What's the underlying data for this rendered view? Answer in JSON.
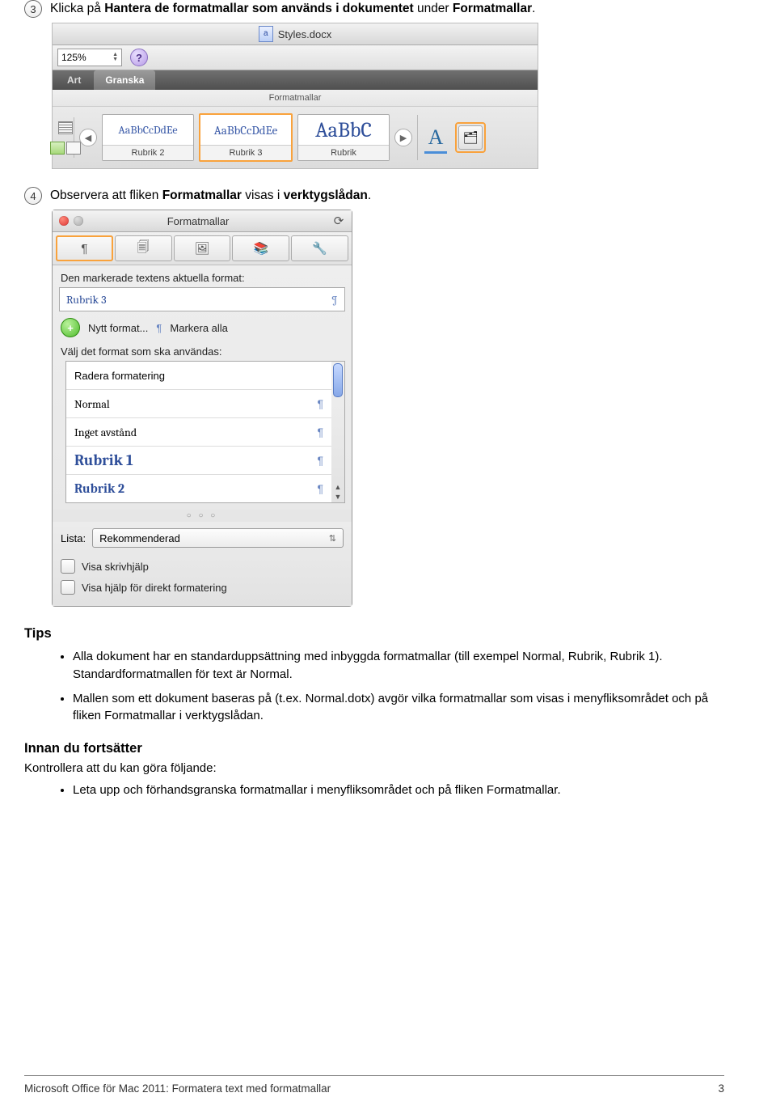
{
  "step3": {
    "num": "3",
    "prefix": "Klicka på ",
    "bold1": "Hantera de formatmallar som används i dokumentet",
    "mid": " under ",
    "bold2": "Formatmallar",
    "suffix": "."
  },
  "ribbon": {
    "doc_title": "Styles.docx",
    "zoom": "125%",
    "tab1": "Art",
    "tab2": "Granska",
    "group_label": "Formatmallar",
    "style_sample": "AaBbCcDdEe",
    "style_sample_big": "AaBbC",
    "style1_name": "Rubrik 2",
    "style2_name": "Rubrik 3",
    "style3_name": "Rubrik"
  },
  "step4": {
    "num": "4",
    "prefix": "Observera att fliken ",
    "bold1": "Formatmallar",
    "mid": " visas i ",
    "bold2": "verktygslådan",
    "suffix": "."
  },
  "panel": {
    "title": "Formatmallar",
    "current_label": "Den markerade textens aktuella format:",
    "current_style": "Rubrik 3",
    "new_style": "Nytt format...",
    "select_all": "Markera alla",
    "choose_label": "Välj det format som ska användas:",
    "items": {
      "0": "Radera formatering",
      "1": "Normal",
      "2": "Inget avstånd",
      "3": "Rubrik 1",
      "4": "Rubrik 2"
    },
    "list_label": "Lista:",
    "list_value": "Rekommenderad",
    "check1": "Visa skrivhjälp",
    "check2": "Visa hjälp för direkt formatering"
  },
  "tips": {
    "heading": "Tips",
    "b1": "Alla dokument har en standarduppsättning med inbyggda formatmallar (till exempel Normal, Rubrik, Rubrik 1). Standardformatmallen för text är Normal.",
    "b2": "Mallen som ett dokument baseras på (t.ex. Normal.dotx) avgör vilka formatmallar som visas i menyfliksområdet och på fliken Formatmallar i verktygslådan."
  },
  "before": {
    "heading": "Innan du fortsätter",
    "lead": "Kontrollera att du kan göra följande:",
    "b1": "Leta upp och förhandsgranska formatmallar i menyfliksområdet och på fliken Formatmallar."
  },
  "footer": {
    "left": "Microsoft Office för Mac 2011: Formatera text med formatmallar",
    "right": "3"
  }
}
